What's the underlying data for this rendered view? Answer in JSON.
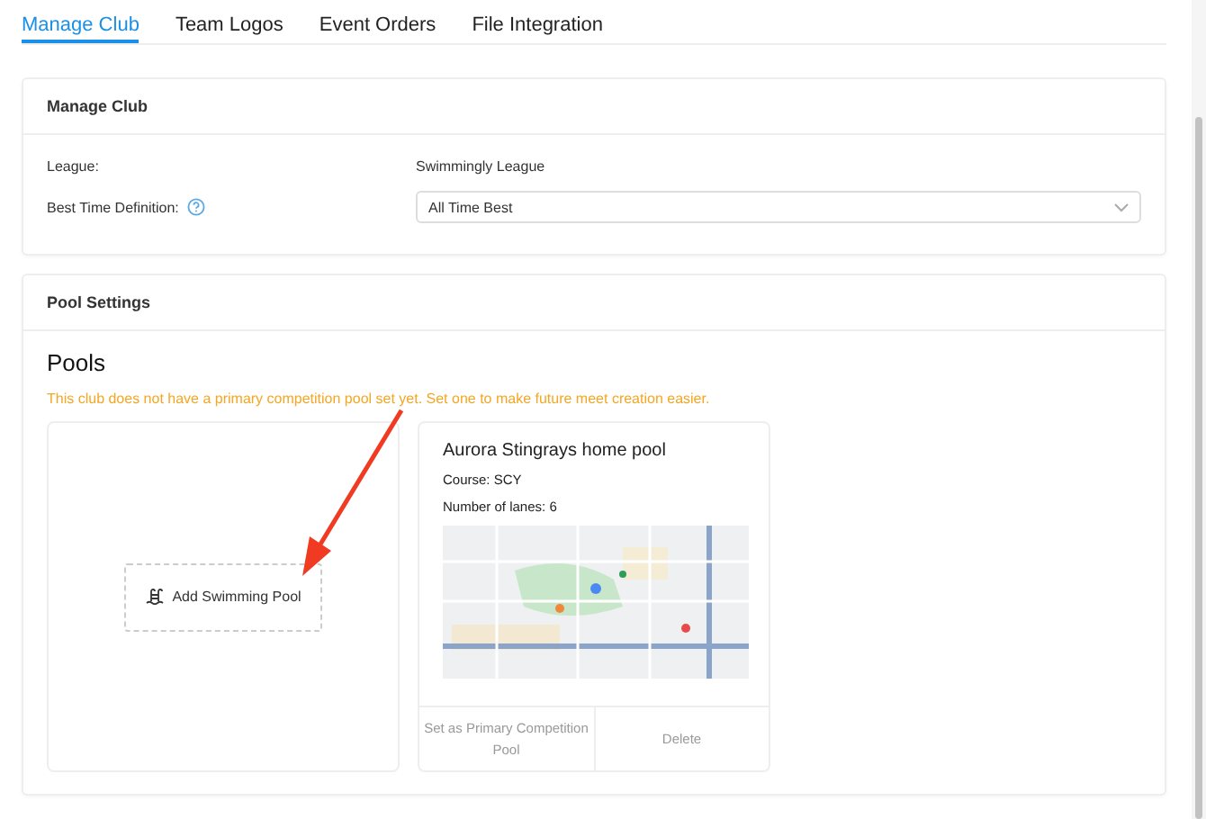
{
  "tabs": [
    {
      "label": "Manage Club",
      "selected": true
    },
    {
      "label": "Team Logos",
      "selected": false
    },
    {
      "label": "Event Orders",
      "selected": false
    },
    {
      "label": "File Integration",
      "selected": false
    }
  ],
  "manage_club": {
    "title": "Manage Club",
    "league_label": "League:",
    "league_value": "Swimmingly League",
    "best_time_label": "Best Time Definition:",
    "best_time_value": "All Time Best"
  },
  "pool_settings": {
    "title": "Pool Settings",
    "heading": "Pools",
    "warning": "This club does not have a primary competition pool set yet. Set one to make future meet creation easier.",
    "add_button": "Add Swimming Pool",
    "pools": [
      {
        "name": "Aurora Stingrays home pool",
        "course": "Course: SCY",
        "lanes": "Number of lanes: 6",
        "actions": [
          "Set as Primary Competition Pool",
          "Delete"
        ]
      }
    ]
  }
}
